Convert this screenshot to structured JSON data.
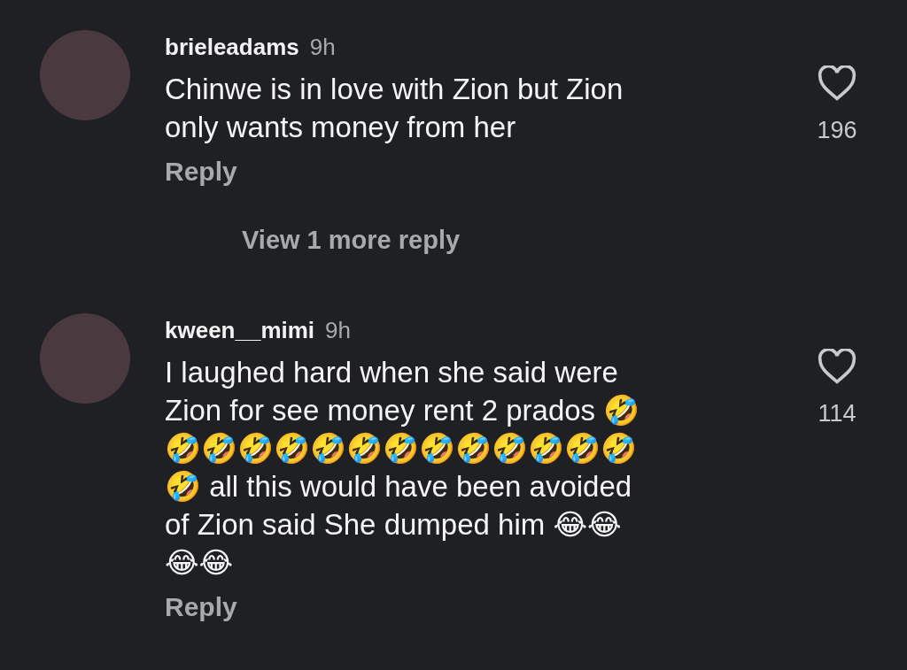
{
  "comments": [
    {
      "username": "brieleadams",
      "time": "9h",
      "text": "Chinwe is in love with Zion but Zion\nonly wants money from her",
      "likes": "196",
      "liked": false,
      "reply_label": "Reply",
      "view_replies": "View 1 more reply"
    },
    {
      "username": "kween__mimi",
      "time": "9h",
      "text": "I laughed hard when she said were\nZion for see money rent 2 prados 🤣\n🤣🤣🤣🤣🤣🤣🤣🤣🤣🤣🤣🤣🤣\n🤣 all this would have been avoided\nof Zion said She dumped him 😂😂\n😂😂",
      "likes": "114",
      "liked": false,
      "reply_label": "Reply"
    }
  ]
}
